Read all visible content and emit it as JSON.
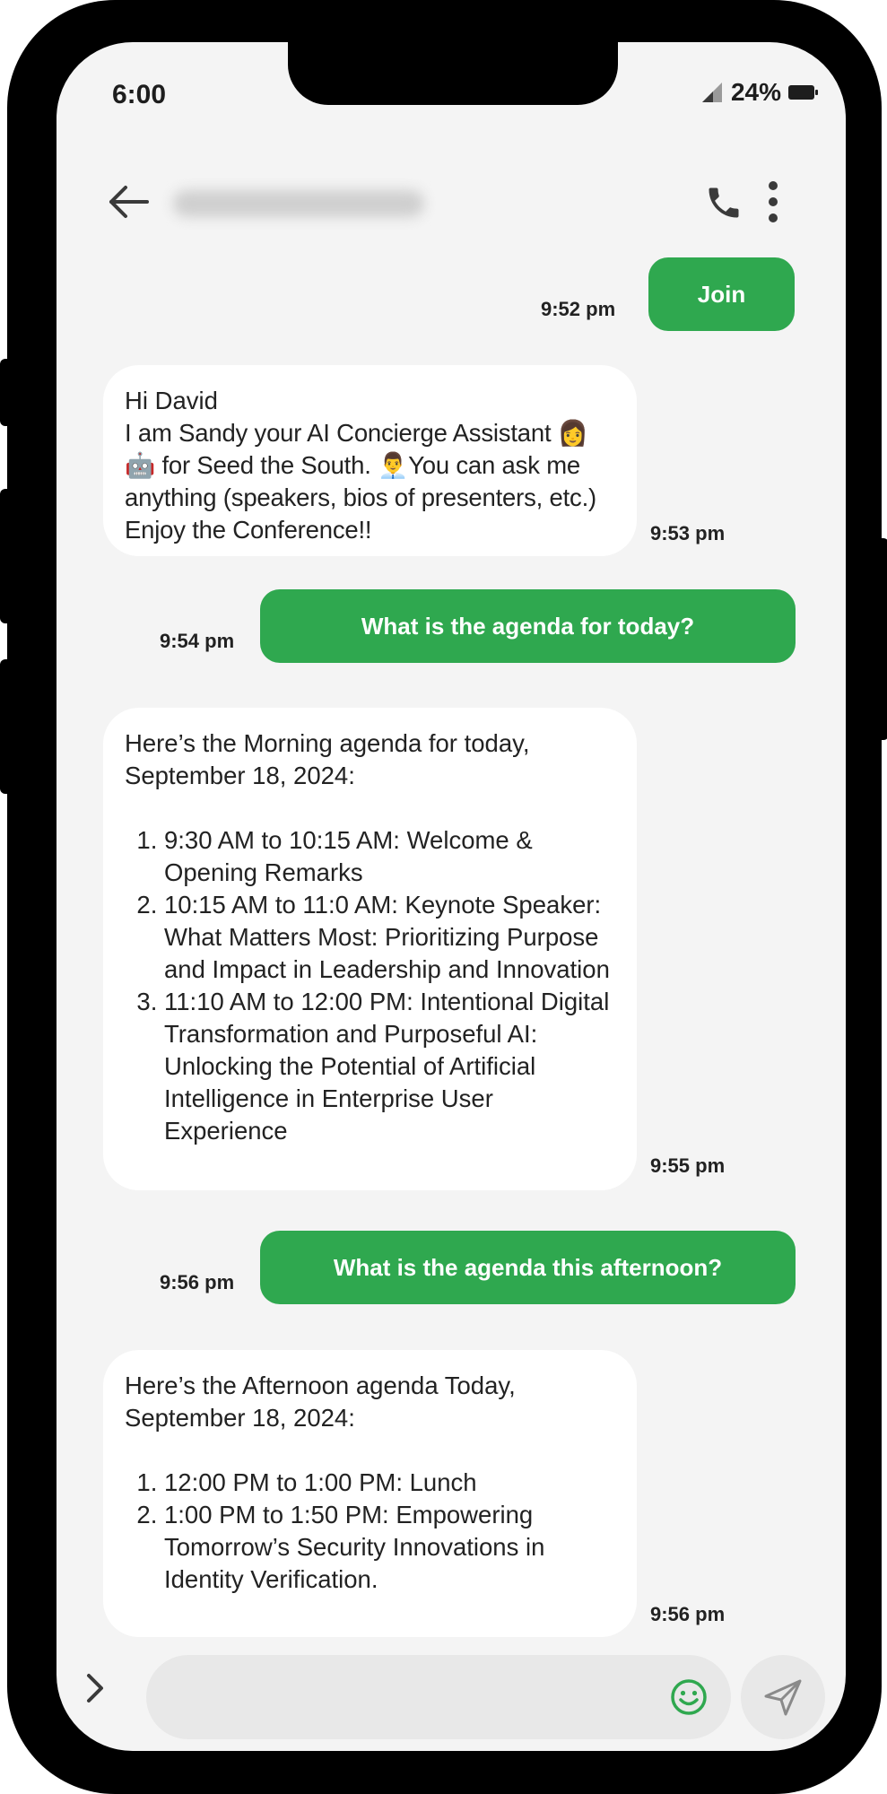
{
  "status_bar": {
    "time": "6:00",
    "battery": "24%"
  },
  "header": {
    "contact_name": "",
    "icons": [
      "back-arrow-icon",
      "phone-icon",
      "more-vertical-icon"
    ]
  },
  "messages": [
    {
      "direction": "outgoing",
      "text": "Join",
      "time": "9:52 pm"
    },
    {
      "direction": "incoming",
      "text": "Hi David\nI am Sandy your AI Concierge Assistant 👩🤖 for Seed the South. 👨‍💼You can ask me anything (speakers, bios of presenters, etc.) Enjoy the Conference!!",
      "greeting": "Hi David",
      "body": "I am Sandy your AI Concierge Assistant 👩🤖 for Seed the South. 👨‍💼You can ask me anything (speakers, bios of presenters, etc.) Enjoy the Conference!!",
      "time": "9:53 pm"
    },
    {
      "direction": "outgoing",
      "text": "What is the agenda for today?",
      "time": "9:54 pm"
    },
    {
      "direction": "incoming",
      "intro": "Here’s the Morning agenda for today, September 18, 2024:",
      "items": [
        "9:30 AM to 10:15 AM: Welcome & Opening Remarks",
        "10:15 AM to 11:0 AM: Keynote Speaker: What Matters Most: Prioritizing Purpose and Impact in Leadership and Innovation",
        "11:10 AM to 12:00 PM: Intentional Digital Transformation and Purposeful AI: Unlocking the Potential of Artificial Intelligence in Enterprise User Experience"
      ],
      "time": "9:55 pm"
    },
    {
      "direction": "outgoing",
      "text": "What is the agenda this afternoon?",
      "time": "9:56 pm"
    },
    {
      "direction": "incoming",
      "intro": "Here’s the Afternoon agenda Today, September 18, 2024:",
      "items": [
        "12:00 PM to 1:00 PM: Lunch",
        "1:00 PM to 1:50 PM: Empowering Tomorrow’s Security Innovations in Identity Verification."
      ],
      "time": "9:56 pm"
    }
  ],
  "composer": {
    "value": "",
    "placeholder": "",
    "icons": [
      "expand-chevron-icon",
      "emoji-icon",
      "send-icon"
    ]
  },
  "colors": {
    "accent": "#2fa84f",
    "background": "#f4f4f4",
    "incoming_bubble": "#ffffff",
    "outgoing_text": "#ffffff"
  }
}
